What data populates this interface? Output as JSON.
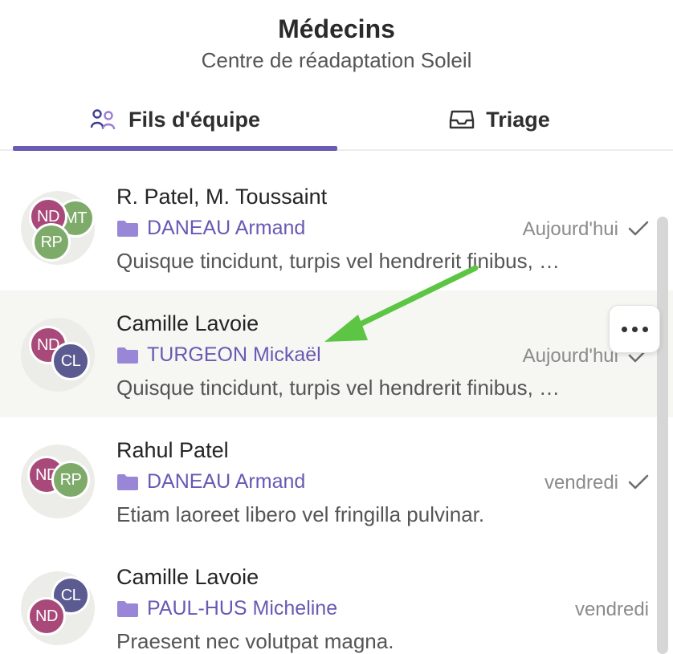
{
  "header": {
    "title": "Médecins",
    "subtitle": "Centre de réadaptation Soleil"
  },
  "tabs": [
    {
      "label": "Fils d'équipe",
      "icon": "team-icon",
      "active": true
    },
    {
      "label": "Triage",
      "icon": "inbox-icon",
      "active": false
    }
  ],
  "threads": [
    {
      "title": "R. Patel, M. Toussaint",
      "patient": "DANEAU Armand",
      "date": "Aujourd'hui",
      "read": true,
      "preview": "Quisque tincidunt, turpis vel hendrerit finibus, …",
      "avatars": [
        "ND",
        "MT",
        "RP"
      ]
    },
    {
      "title": "Camille Lavoie",
      "patient": "TURGEON Mickaël",
      "date": "Aujourd'hui",
      "read": true,
      "preview": "Quisque tincidunt, turpis vel hendrerit finibus, …",
      "avatars": [
        "ND",
        "CL"
      ]
    },
    {
      "title": "Rahul Patel",
      "patient": "DANEAU Armand",
      "date": "vendredi",
      "read": true,
      "preview": "Etiam laoreet libero vel fringilla pulvinar.",
      "avatars": [
        "ND",
        "RP"
      ]
    },
    {
      "title": "Camille Lavoie",
      "patient": "PAUL-HUS Micheline",
      "date": "vendredi",
      "read": false,
      "preview": "Praesent nec volutpat magna.",
      "avatars": [
        "CL",
        "ND"
      ]
    }
  ],
  "colors": {
    "accent": "#6b5bb5",
    "patient_text": "#6a58b4",
    "avatar_nd": "#a8497a",
    "avatar_green": "#7eab6a",
    "avatar_cl": "#5b5a91",
    "highlight_row": "#f6f6f2",
    "annotation_arrow": "#5cc644"
  },
  "overlay": {
    "more_button_icon": "more-horizontal-icon"
  }
}
